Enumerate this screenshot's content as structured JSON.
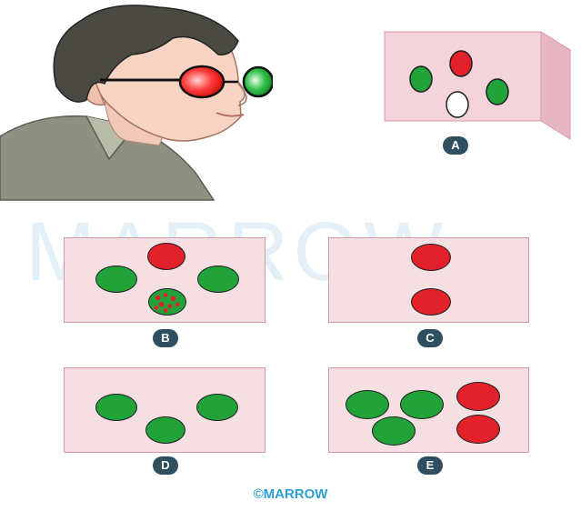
{
  "watermark": "MARROW",
  "copyright": "©MARROW",
  "panels": [
    {
      "label": "A"
    },
    {
      "label": "B"
    },
    {
      "label": "C"
    },
    {
      "label": "D"
    },
    {
      "label": "E"
    }
  ],
  "colors": {
    "panel_fill": "#f6dfe3",
    "panel_border": "#d69aa7",
    "green_light": "#22a33a",
    "red_light": "#e3212b",
    "white_light": "#ffffff",
    "badge": "#2f4f60",
    "brand": "#2c9fd0"
  }
}
